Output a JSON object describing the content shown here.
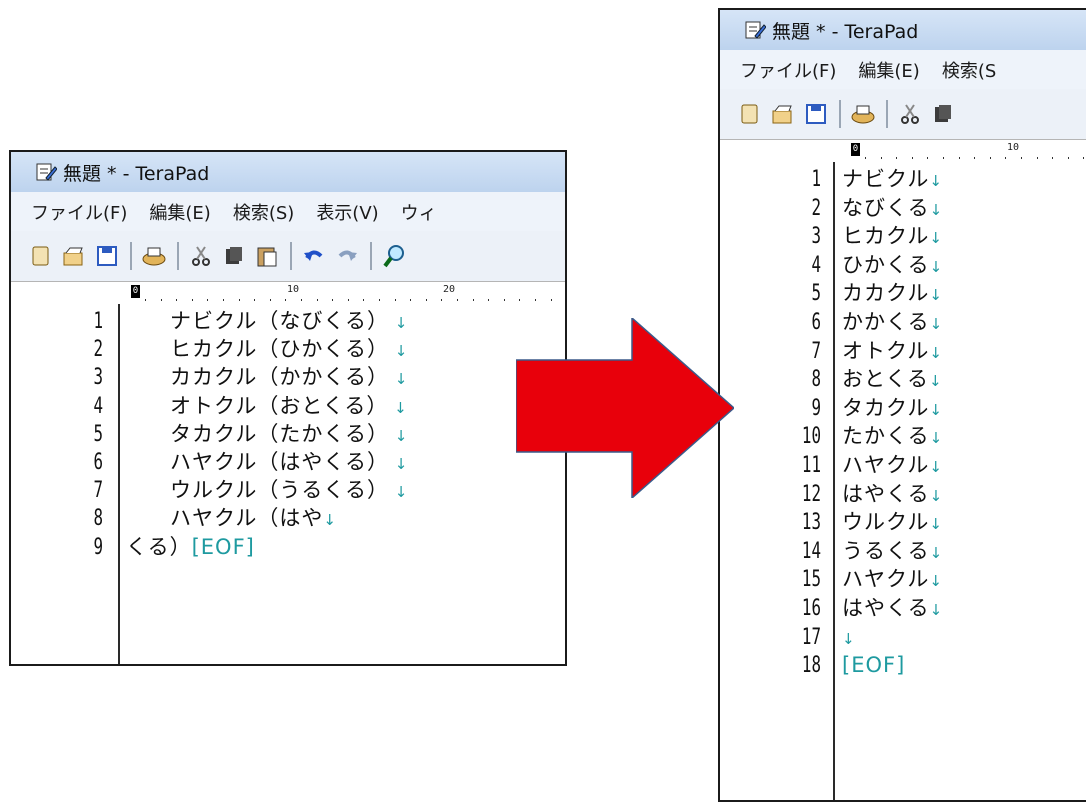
{
  "left_window": {
    "title": "無題 * - TeraPad",
    "menu": [
      "ファイル(F)",
      "編集(E)",
      "検索(S)",
      "表示(V)",
      "ウィ"
    ],
    "ruler_labels": [
      "0",
      "10",
      "20"
    ],
    "line_numbers": [
      "1",
      "2",
      "3",
      "4",
      "5",
      "6",
      "7",
      "8",
      "9"
    ],
    "lines": [
      {
        "text": "　　ナビクル（なびくる）",
        "mark": " ↓",
        "eof": ""
      },
      {
        "text": "　　ヒカクル（ひかくる）",
        "mark": " ↓",
        "eof": ""
      },
      {
        "text": "　　カカクル（かかくる）",
        "mark": " ↓",
        "eof": ""
      },
      {
        "text": "　　オトクル（おとくる）",
        "mark": " ↓",
        "eof": ""
      },
      {
        "text": "　　タカクル（たかくる）",
        "mark": " ↓",
        "eof": ""
      },
      {
        "text": "　　ハヤクル（はやくる）",
        "mark": " ↓",
        "eof": ""
      },
      {
        "text": "　　ウルクル（うるくる）",
        "mark": " ↓",
        "eof": ""
      },
      {
        "text": "　　ハヤクル（はや",
        "mark": "↓",
        "eof": ""
      },
      {
        "text": "くる）",
        "mark": "",
        "eof": "[EOF]"
      }
    ]
  },
  "right_window": {
    "title": "無題 * - TeraPad",
    "menu": [
      "ファイル(F)",
      "編集(E)",
      "検索(S"
    ],
    "ruler_labels": [
      "0",
      "10"
    ],
    "line_numbers": [
      "1",
      "2",
      "3",
      "4",
      "5",
      "6",
      "7",
      "8",
      "9",
      "10",
      "11",
      "12",
      "13",
      "14",
      "15",
      "16",
      "17",
      "18"
    ],
    "lines": [
      {
        "text": "ナビクル",
        "mark": "↓",
        "eof": ""
      },
      {
        "text": "なびくる",
        "mark": "↓",
        "eof": ""
      },
      {
        "text": "ヒカクル",
        "mark": "↓",
        "eof": ""
      },
      {
        "text": "ひかくる",
        "mark": "↓",
        "eof": ""
      },
      {
        "text": "カカクル",
        "mark": "↓",
        "eof": ""
      },
      {
        "text": "かかくる",
        "mark": "↓",
        "eof": ""
      },
      {
        "text": "オトクル",
        "mark": "↓",
        "eof": ""
      },
      {
        "text": "おとくる",
        "mark": "↓",
        "eof": ""
      },
      {
        "text": "タカクル",
        "mark": "↓",
        "eof": ""
      },
      {
        "text": "たかくる",
        "mark": "↓",
        "eof": ""
      },
      {
        "text": "ハヤクル",
        "mark": "↓",
        "eof": ""
      },
      {
        "text": "はやくる",
        "mark": "↓",
        "eof": ""
      },
      {
        "text": "ウルクル",
        "mark": "↓",
        "eof": ""
      },
      {
        "text": "うるくる",
        "mark": "↓",
        "eof": ""
      },
      {
        "text": "ハヤクル",
        "mark": "↓",
        "eof": ""
      },
      {
        "text": "はやくる",
        "mark": "↓",
        "eof": ""
      },
      {
        "text": "",
        "mark": "↓",
        "eof": ""
      },
      {
        "text": "",
        "mark": "",
        "eof": "[EOF]"
      }
    ]
  },
  "toolbar_icons": [
    "new-file-icon",
    "open-folder-icon",
    "save-icon",
    "print-icon",
    "cut-icon",
    "copy-icon",
    "paste-icon",
    "undo-icon",
    "redo-icon",
    "find-icon"
  ],
  "colors": {
    "arrow": "#e8000b",
    "marker": "#1e9aa0",
    "title_bar": "#c9dcf2"
  }
}
